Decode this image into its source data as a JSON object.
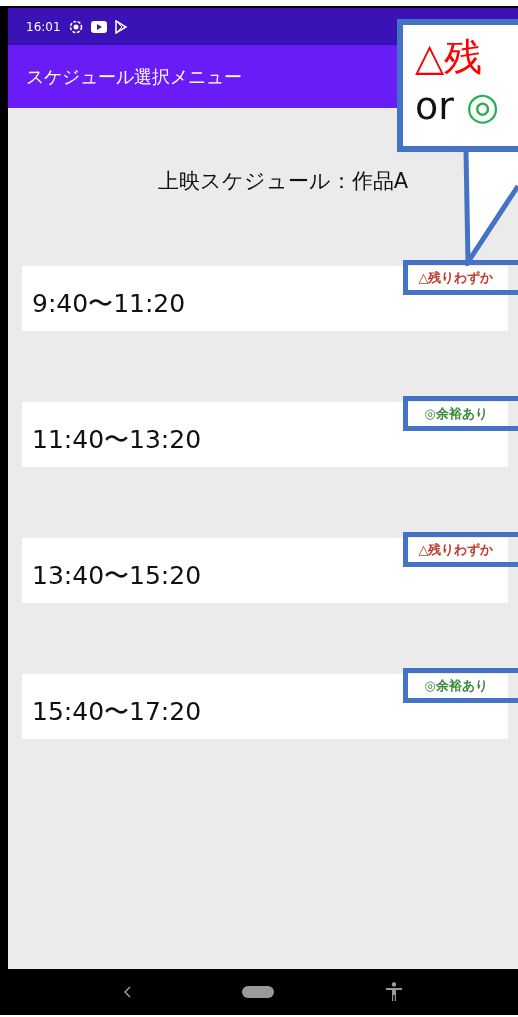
{
  "status_bar": {
    "time": "16:01"
  },
  "app_bar": {
    "title": "スケジュール選択メニュー"
  },
  "heading": "上映スケジュール：作品A",
  "schedules": [
    {
      "time": "9:40〜11:20",
      "badge": "△残りわずか",
      "color": "#c0392b",
      "highlighted": true
    },
    {
      "time": "11:40〜13:20",
      "badge": "◎余裕あり",
      "color": "#3a8a3a",
      "highlighted": true
    },
    {
      "time": "13:40〜15:20",
      "badge": "△残りわずか",
      "color": "#c0392b",
      "highlighted": true
    },
    {
      "time": "15:40〜17:20",
      "badge": "◎余裕あり",
      "color": "#3a8a3a",
      "highlighted": true
    }
  ],
  "callout": {
    "lines": [
      {
        "segments": [
          {
            "text": "△残",
            "color": "#ff0000"
          }
        ]
      },
      {
        "segments": [
          {
            "text": "or",
            "color": "#111111"
          },
          {
            "text": "◎",
            "color": "#22b14c"
          }
        ]
      }
    ]
  }
}
